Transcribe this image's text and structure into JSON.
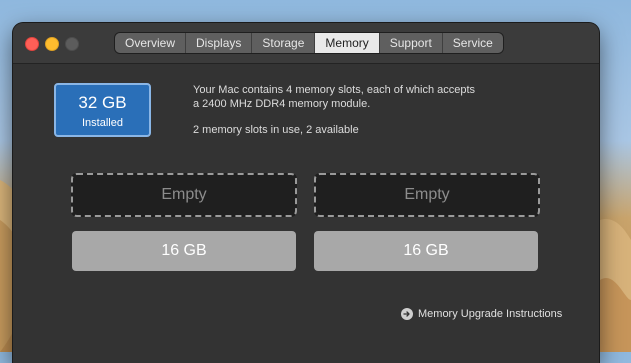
{
  "window": {
    "tabs": [
      {
        "label": "Overview",
        "active": false
      },
      {
        "label": "Displays",
        "active": false
      },
      {
        "label": "Storage",
        "active": false
      },
      {
        "label": "Memory",
        "active": true
      },
      {
        "label": "Support",
        "active": false
      },
      {
        "label": "Service",
        "active": false
      }
    ]
  },
  "memory": {
    "installed_amount": "32 GB",
    "installed_label": "Installed",
    "description_line1": "Your Mac contains 4 memory slots, each of which accepts",
    "description_line2": "a 2400 MHz DDR4 memory module.",
    "slots_status": "2 memory slots in use, 2 available",
    "slots": [
      {
        "label": "Empty",
        "state": "empty"
      },
      {
        "label": "Empty",
        "state": "empty"
      },
      {
        "label": "16 GB",
        "state": "installed"
      },
      {
        "label": "16 GB",
        "state": "installed"
      }
    ],
    "upgrade_link": "Memory Upgrade Instructions"
  },
  "colors": {
    "installed_box": "#2a6fb8",
    "window_bg": "#333333",
    "filled_slot": "#a8a8a8"
  },
  "icons": {
    "upgrade_link_icon": "arrow-right-circle-icon"
  }
}
